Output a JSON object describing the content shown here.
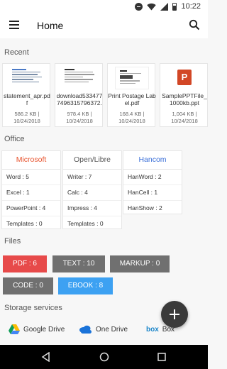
{
  "status_bar": {
    "time": "10:22"
  },
  "app_bar": {
    "title": "Home"
  },
  "sections": {
    "recent": "Recent",
    "office": "Office",
    "files": "Files",
    "storage": "Storage services"
  },
  "recent": [
    {
      "name": "statement_apr.pdf",
      "size": "586.2 KB |",
      "date": "10/24/2018",
      "thumb": "document-thumb"
    },
    {
      "name": "download5334777496315796372.",
      "size": "978.4 KB |",
      "date": "10/24/2018",
      "thumb": "document-thumb"
    },
    {
      "name": "Print Postage Label.pdf",
      "size": "168.4 KB |",
      "date": "10/24/2018",
      "thumb": "label-thumb"
    },
    {
      "name": "SamplePPTFile_1000kb.ppt",
      "size": "1,004 KB |",
      "date": "10/24/2018",
      "thumb": "powerpoint-icon"
    }
  ],
  "office": [
    {
      "name": "Microsoft",
      "color": "#e8532d",
      "rows": [
        "Word : 5",
        "Excel : 1",
        "PowerPoint : 4",
        "Templates : 0"
      ]
    },
    {
      "name": "Open/Libre",
      "color": "#555555",
      "rows": [
        "Writer : 7",
        "Calc : 4",
        "Impress : 4",
        "Templates : 0"
      ]
    },
    {
      "name": "Hancom",
      "color": "#3a6fd8",
      "rows": [
        "HanWord : 2",
        "HanCell : 1",
        "HanShow : 2"
      ]
    }
  ],
  "files": [
    {
      "label": "PDF : 6",
      "color": "#e74a4a"
    },
    {
      "label": "TEXT : 10",
      "color": "#707070"
    },
    {
      "label": "MARKUP : 0",
      "color": "#707070"
    },
    {
      "label": "CODE : 0",
      "color": "#707070"
    },
    {
      "label": "EBOOK : 8",
      "color": "#3da1f2"
    }
  ],
  "storage": [
    {
      "label": "Google Drive",
      "icon": "google-drive-icon"
    },
    {
      "label": "One Drive",
      "icon": "onedrive-icon"
    },
    {
      "label": "Box",
      "logo": "box",
      "icon": "box-icon"
    }
  ]
}
